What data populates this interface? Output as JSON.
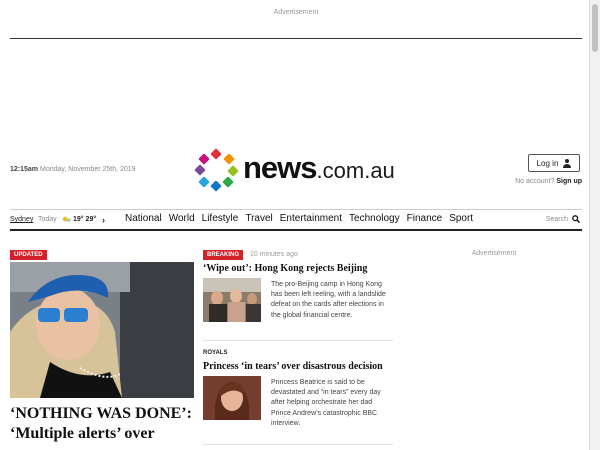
{
  "ads": {
    "top_label": "Advertisement",
    "side_label": "Advertisement"
  },
  "header": {
    "time": "12:15am",
    "date": "Monday, November 25th, 2019",
    "logo_word": "news",
    "logo_suffix": ".com.au",
    "login_label": "Log in",
    "no_account": "No account?",
    "signup": "Sign up"
  },
  "weather": {
    "location": "Sydney",
    "today": "Today",
    "low": "19°",
    "high": "29°",
    "icon": "partly-sunny-icon"
  },
  "nav": {
    "links": [
      "National",
      "World",
      "Lifestyle",
      "Travel",
      "Entertainment",
      "Technology",
      "Finance",
      "Sport"
    ],
    "search_label": "Search"
  },
  "hero": {
    "badge": "UPDATED",
    "headline_line1": "‘NOTHING WAS DONE’:",
    "headline_line2": "‘Multiple alerts’ over"
  },
  "stories": [
    {
      "badge": "BREAKING",
      "time": "10 minutes ago",
      "headline": "‘Wipe out’: Hong Kong rejects Beijing",
      "summary": "The pro-Beijing camp in Hong Kong has been left reeling, with a landslide defeat on the cards after elections in the global financial centre."
    },
    {
      "kicker": "ROYALS",
      "headline": "Princess ‘in tears’ over disastrous decision",
      "summary": "Princess Beatrice is said to be devastated and “in tears” every day after helping orchestrate her dad Prince Andrew’s catastrophic BBC interview."
    }
  ],
  "colors": {
    "accent_red": "#d1212a",
    "text_dark": "#111111",
    "muted": "#888888"
  }
}
